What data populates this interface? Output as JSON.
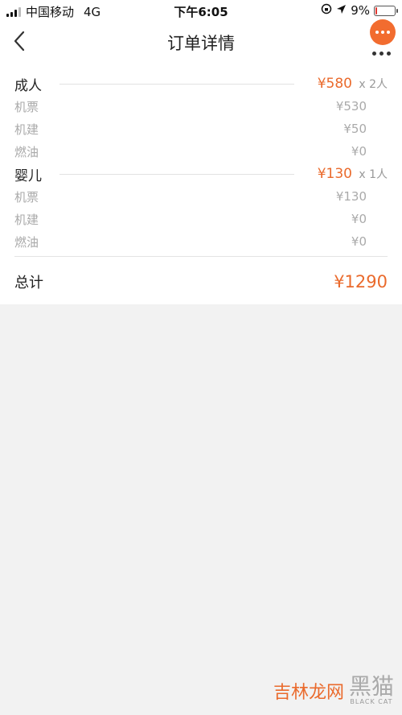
{
  "status_bar": {
    "carrier": "中国移动",
    "network": "4G",
    "time": "下午6:05",
    "battery": "9%",
    "battery_level": 0.09
  },
  "nav": {
    "title": "订单详情"
  },
  "groups": [
    {
      "name": "成人",
      "price": "¥580",
      "qty": "x 2人",
      "items": [
        {
          "label": "机票",
          "price": "¥530"
        },
        {
          "label": "机建",
          "price": "¥50"
        },
        {
          "label": "燃油",
          "price": "¥0"
        }
      ]
    },
    {
      "name": "婴儿",
      "price": "¥130",
      "qty": "x 1人",
      "items": [
        {
          "label": "机票",
          "price": "¥130"
        },
        {
          "label": "机建",
          "price": "¥0"
        },
        {
          "label": "燃油",
          "price": "¥0"
        }
      ]
    }
  ],
  "total": {
    "label": "总计",
    "value": "¥1290"
  },
  "watermark": {
    "text": "吉林龙网",
    "logo": "黑猫",
    "sub": "BLACK CAT"
  },
  "colors": {
    "accent": "#ea6a2c"
  }
}
